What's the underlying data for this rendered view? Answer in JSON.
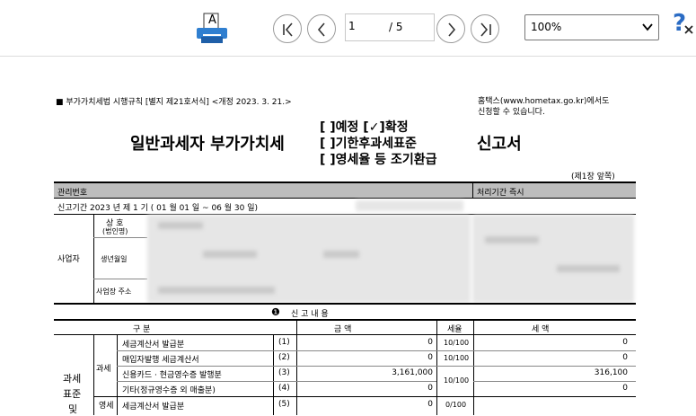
{
  "toolbar": {
    "print_label": "A",
    "page_current": "1",
    "page_total": "/ 5",
    "zoom_value": "100%",
    "help_label": "?"
  },
  "doc": {
    "law_line": "■ 부가가치세법 시행규칙 [별지 제21호서식] <개정 2023. 3. 21.>",
    "hometax_note_1": "홈택스(www.hometax.go.kr)에서도",
    "hometax_note_2": "신청할 수 있습니다.",
    "opt_1": "[  ]예정  [✓]확정",
    "opt_2": "[  ]기한후과세표준",
    "opt_3": "[  ]영세율 등 조기환급",
    "title_left": "일반과세자 부가가치세",
    "title_right": "신고서",
    "page_note": "(제1장 앞쪽)",
    "mgmt_no": "관리번호",
    "processing": "처리기간  즉시",
    "period": "신고기간  2023 년  제  1  기 (  01  월     01  일 ~ 06  월    30  일)",
    "business": "사업자",
    "trade_name": "상    호",
    "trade_name_sub": "(법인명)",
    "birth": "생년월일",
    "address": "사업장 주소",
    "section_num": "❶",
    "section_title": "신     고     내     용",
    "col_category": "구                    분",
    "col_amount": "금          액",
    "col_rate": "세율",
    "col_tax": "세          액",
    "side_1": "과세",
    "side_2": "표준",
    "side_3": "및",
    "sub_1": "과세",
    "sub_2": "영세",
    "rows": [
      {
        "label": "세금계산서 발급분",
        "no": "(1)",
        "amount": "0",
        "rate": "10/100",
        "tax": "0"
      },
      {
        "label": "매입자발행 세금계산서",
        "no": "(2)",
        "amount": "0",
        "rate": "10/100",
        "tax": "0"
      },
      {
        "label": "신용카드 · 현금영수증 발행분",
        "no": "(3)",
        "amount": "3,161,000",
        "rate": "10/100",
        "tax": "316,100"
      },
      {
        "label": "기타(정규영수증 외 매출분)",
        "no": "(4)",
        "amount": "0",
        "rate": "",
        "tax": "0"
      },
      {
        "label": "세금계산서 발급분",
        "no": "(5)",
        "amount": "0",
        "rate": "0/100",
        "tax": ""
      }
    ]
  }
}
